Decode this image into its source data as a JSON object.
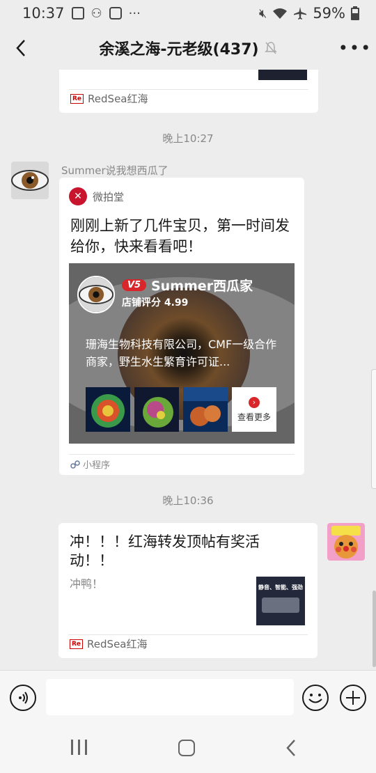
{
  "status": {
    "time": "10:37",
    "battery": "59%"
  },
  "header": {
    "title": "余溪之海-元老级(437)"
  },
  "messages": {
    "top_source": "RedSea红海",
    "time1": "晚上10:27",
    "sender_name": "Summer说我想西瓜了",
    "mini": {
      "app_name": "微拍堂",
      "text": "刚刚上新了几件宝贝，第一时间发给你，快来看看吧！",
      "badge": "V5",
      "shop_name": "Summer西瓜家",
      "shop_score": "店铺评分 4.99",
      "description": "珊海生物科技有限公司，CMF一级合作商家，野生水生繁育许可证...",
      "see_more": "查看更多",
      "footer": "小程序"
    },
    "time2": "晚上10:36",
    "link": {
      "title": "冲！！！红海转发顶帖有奖活动！！",
      "subtitle": "冲鸭！",
      "thumb_text": "静音、智能、强劲",
      "source": "RedSea红海"
    }
  },
  "colors": {
    "accent_red": "#d8262a",
    "bg": "#ededed"
  }
}
